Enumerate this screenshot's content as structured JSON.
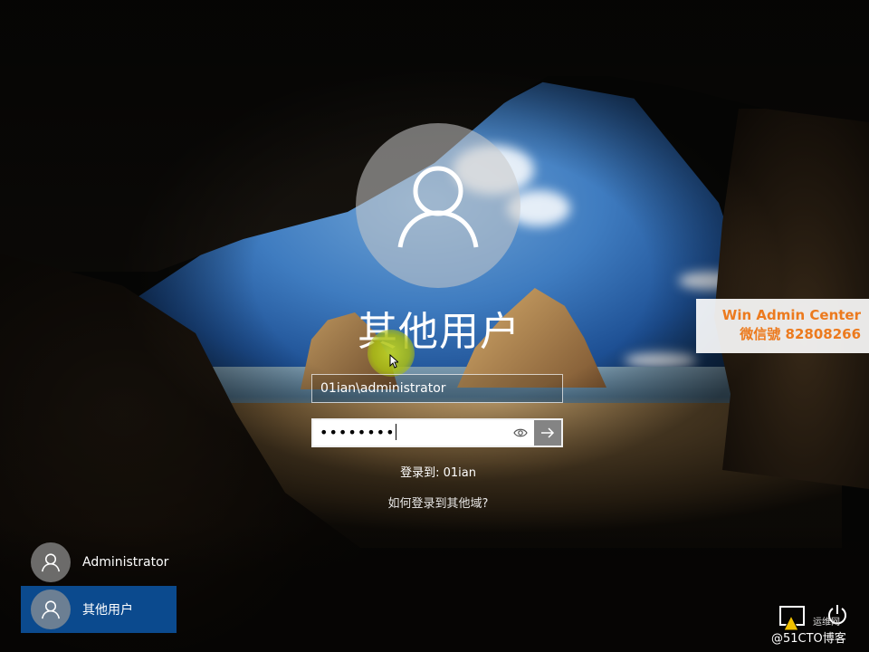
{
  "login": {
    "user_title": "其他用户",
    "username_value": "01ian\\administrator",
    "password_mask": "••••••••",
    "domain_text": "登录到: 01ian",
    "other_domain_link": "如何登录到其他域?"
  },
  "user_list": [
    {
      "label": "Administrator",
      "selected": false
    },
    {
      "label": "其他用户",
      "selected": true
    }
  ],
  "watermark": {
    "line1": "Win Admin Center",
    "line2": "微信號 82808266",
    "color": "#ec7a1e"
  },
  "blog_watermark": {
    "text": "@51CTO博客",
    "sub": "运维网"
  },
  "icons": [
    "user-icon",
    "eye-icon",
    "arrow-right-icon",
    "accessibility-icon",
    "power-icon",
    "mouse-cursor-icon"
  ],
  "colors": {
    "selected_user_bg": "#0b4a8e",
    "cursor_highlight": "#b4c81e"
  }
}
